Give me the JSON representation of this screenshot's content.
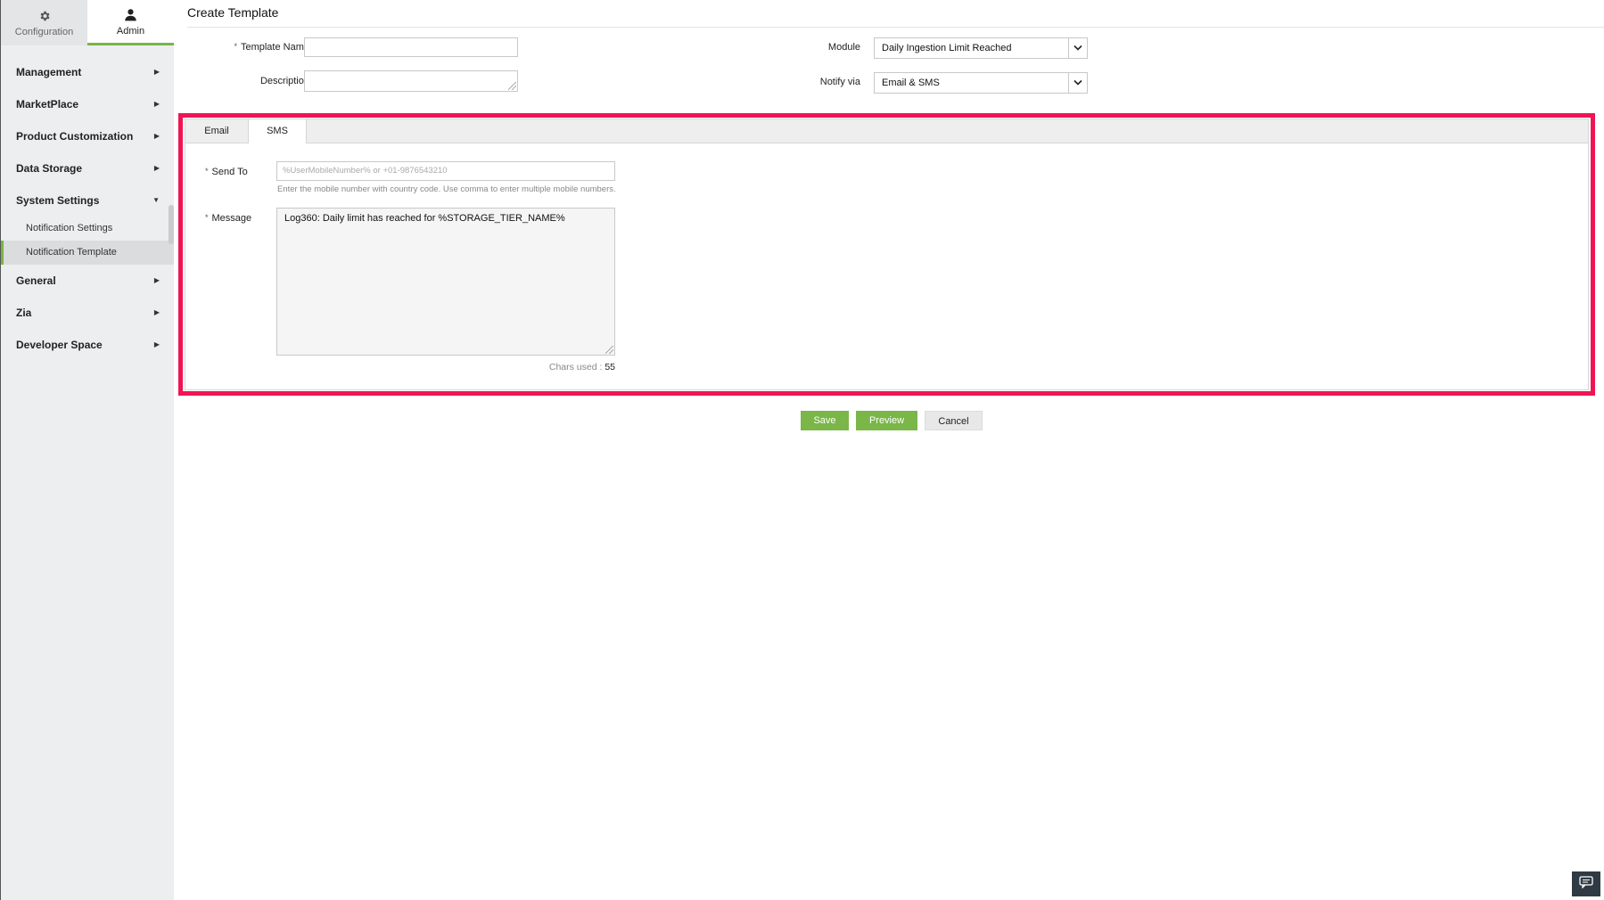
{
  "sidebar": {
    "top_tabs": [
      {
        "label": "Configuration",
        "icon": "gear-icon"
      },
      {
        "label": "Admin",
        "icon": "user-icon",
        "active": true
      }
    ],
    "items": [
      {
        "label": "Management"
      },
      {
        "label": "MarketPlace"
      },
      {
        "label": "Product Customization"
      },
      {
        "label": "Data Storage"
      },
      {
        "label": "System Settings",
        "expanded": true,
        "children": [
          {
            "label": "Notification Settings"
          },
          {
            "label": "Notification Template",
            "active": true
          }
        ]
      },
      {
        "label": "General"
      },
      {
        "label": "Zia"
      },
      {
        "label": "Developer Space"
      }
    ]
  },
  "header": {
    "title": "Create Template"
  },
  "form": {
    "required_mark": "*",
    "template_name": {
      "label": "Template Name",
      "value": ""
    },
    "description": {
      "label": "Description",
      "value": ""
    },
    "module": {
      "label": "Module",
      "value": "Daily Ingestion Limit Reached"
    },
    "notify_via": {
      "label": "Notify via",
      "value": "Email & SMS"
    }
  },
  "tabs": [
    {
      "label": "Email"
    },
    {
      "label": "SMS",
      "active": true
    }
  ],
  "sms": {
    "send_to": {
      "label": "Send To",
      "placeholder": "%UserMobileNumber% or +01-9876543210",
      "hint": "Enter the mobile number with country code. Use comma to enter multiple mobile numbers."
    },
    "message": {
      "label": "Message",
      "value": "Log360: Daily limit has reached for %STORAGE_TIER_NAME%"
    },
    "chars_used_label": "Chars used :",
    "chars_used_value": "55"
  },
  "buttons": {
    "save": "Save",
    "preview": "Preview",
    "cancel": "Cancel"
  },
  "colors": {
    "accent": "#79b544",
    "highlight": "#f01454",
    "button_green": "#7ab648"
  }
}
